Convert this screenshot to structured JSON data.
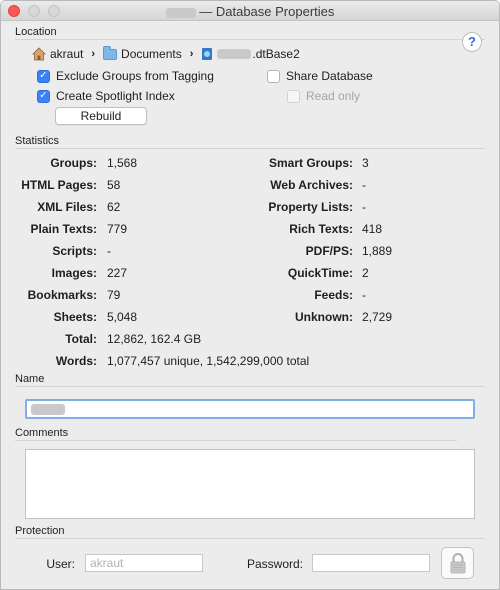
{
  "window": {
    "title_suffix": "— Database Properties"
  },
  "location": {
    "section_label": "Location",
    "help_label": "?",
    "path": {
      "user": "akraut",
      "folder": "Documents",
      "file_suffix": ".dtBase2"
    },
    "separator": "›",
    "exclude_groups_label": "Exclude Groups from Tagging",
    "exclude_groups_checked": true,
    "spotlight_label": "Create Spotlight Index",
    "spotlight_checked": true,
    "share_label": "Share Database",
    "share_checked": false,
    "readonly_label": "Read only",
    "readonly_checked": false,
    "rebuild_label": "Rebuild"
  },
  "statistics": {
    "section_label": "Statistics",
    "left": [
      {
        "key": "Groups:",
        "value": "1,568"
      },
      {
        "key": "HTML Pages:",
        "value": "58"
      },
      {
        "key": "XML Files:",
        "value": "62"
      },
      {
        "key": "Plain Texts:",
        "value": "779"
      },
      {
        "key": "Scripts:",
        "value": "-"
      },
      {
        "key": "Images:",
        "value": "227"
      },
      {
        "key": "Bookmarks:",
        "value": "79"
      },
      {
        "key": "Sheets:",
        "value": "5,048"
      },
      {
        "key": "Total:",
        "value": "12,862, 162.4 GB"
      },
      {
        "key": "Words:",
        "value": "1,077,457 unique, 1,542,299,000 total"
      }
    ],
    "right": [
      {
        "key": "Smart Groups:",
        "value": "3"
      },
      {
        "key": "Web Archives:",
        "value": "-"
      },
      {
        "key": "Property Lists:",
        "value": "-"
      },
      {
        "key": "Rich Texts:",
        "value": "418"
      },
      {
        "key": "PDF/PS:",
        "value": "1,889"
      },
      {
        "key": "QuickTime:",
        "value": "2"
      },
      {
        "key": "Feeds:",
        "value": "-"
      },
      {
        "key": "Unknown:",
        "value": "2,729"
      }
    ]
  },
  "name": {
    "section_label": "Name"
  },
  "comments": {
    "section_label": "Comments"
  },
  "protection": {
    "section_label": "Protection",
    "user_label": "User:",
    "user_placeholder": "akraut",
    "password_label": "Password:",
    "password_placeholder": ""
  },
  "icons": {
    "home": "home-icon",
    "folder": "folder-icon",
    "database": "database-file-icon",
    "lock": "lock-icon",
    "help": "help-icon"
  },
  "colors": {
    "accent": "#3b82f6",
    "close_button": "#fc5753"
  }
}
